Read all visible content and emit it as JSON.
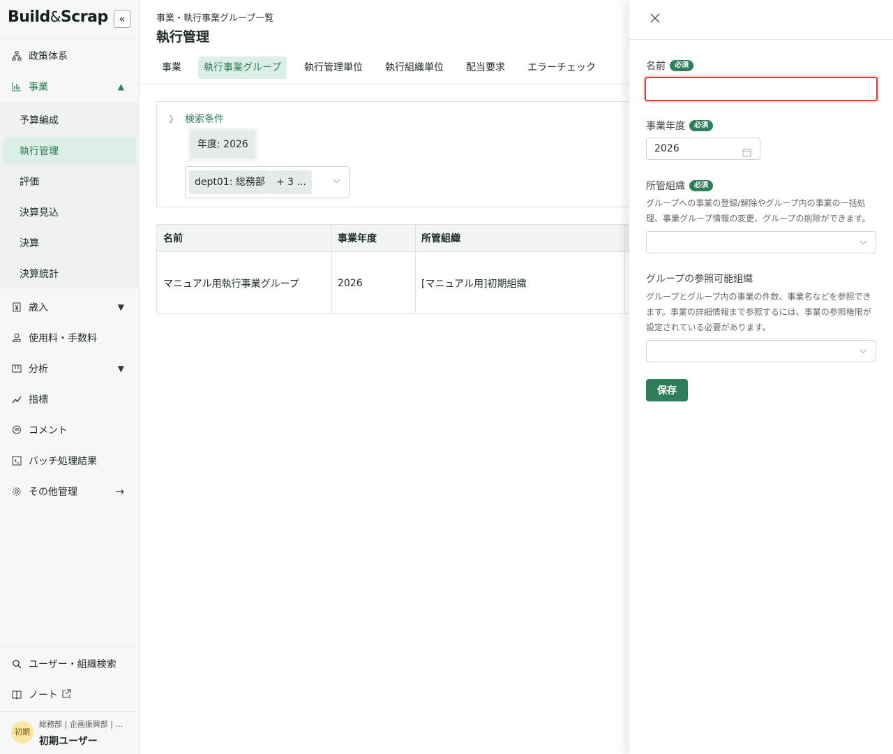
{
  "sidebar": {
    "logo": {
      "build": "Build",
      "amp": "&",
      "scrap": "Scrap"
    },
    "collapse_label": "«",
    "items": [
      {
        "label": "政策体系",
        "icon": "hierarchy-icon"
      },
      {
        "label": "事業",
        "icon": "bar-chart-icon"
      },
      {
        "label": "歳入",
        "icon": "yen-doc-icon"
      },
      {
        "label": "使用料・手数料",
        "icon": "hand-coin-icon"
      },
      {
        "label": "分析",
        "icon": "board-icon"
      },
      {
        "label": "指標",
        "icon": "trend-icon"
      },
      {
        "label": "コメント",
        "icon": "comment-icon"
      },
      {
        "label": "バッチ処理結果",
        "icon": "terminal-icon"
      },
      {
        "label": "その他管理",
        "icon": "gear-icon"
      }
    ],
    "sub_items": [
      {
        "label": "予算編成"
      },
      {
        "label": "執行管理"
      },
      {
        "label": "評価"
      },
      {
        "label": "決算見込"
      },
      {
        "label": "決算"
      },
      {
        "label": "決算統計"
      }
    ],
    "bottom_items": [
      {
        "label": "ユーザー・組織検索"
      },
      {
        "label": "ノート"
      }
    ],
    "user": {
      "avatar": "初期",
      "dept": "総務部 | 企画振興部 | …",
      "name": "初期ユーザー"
    }
  },
  "main": {
    "breadcrumb": "事業・執行事業グループ一覧",
    "title": "執行管理",
    "tabs": [
      {
        "label": "事業"
      },
      {
        "label": "執行事業グループ"
      },
      {
        "label": "執行管理単位"
      },
      {
        "label": "執行組織単位"
      },
      {
        "label": "配当要求"
      },
      {
        "label": "エラーチェック"
      }
    ],
    "search": {
      "title": "検索条件",
      "year_chip": "年度: 2026",
      "dept_chip": "dept01: 総務部",
      "more_chip": "+ 3 ..."
    },
    "table": {
      "headers": [
        "名前",
        "事業年度",
        "所管組織"
      ],
      "rows": [
        [
          "マニュアル用執行事業グループ",
          "2026",
          "[マニュアル用]初期組織"
        ]
      ]
    }
  },
  "panel": {
    "name_label": "名前",
    "required": "必須",
    "name_value": "",
    "year_label": "事業年度",
    "year_value": "2026",
    "org_label": "所管組織",
    "org_help": "グループへの事業の登録/解除やグループ内の事業の一括処理、事業グループ情報の変更、グループの削除ができます。",
    "ref_label": "グループの参照可能組織",
    "ref_help": "グループとグループ内の事業の件数、事業名などを参照できます。事業の詳細情報まで参照するには、事業の参照権限が設定されている必要があります。",
    "save_label": "保存"
  },
  "colors": {
    "accent": "#2e7d5b",
    "error": "#e53935"
  }
}
